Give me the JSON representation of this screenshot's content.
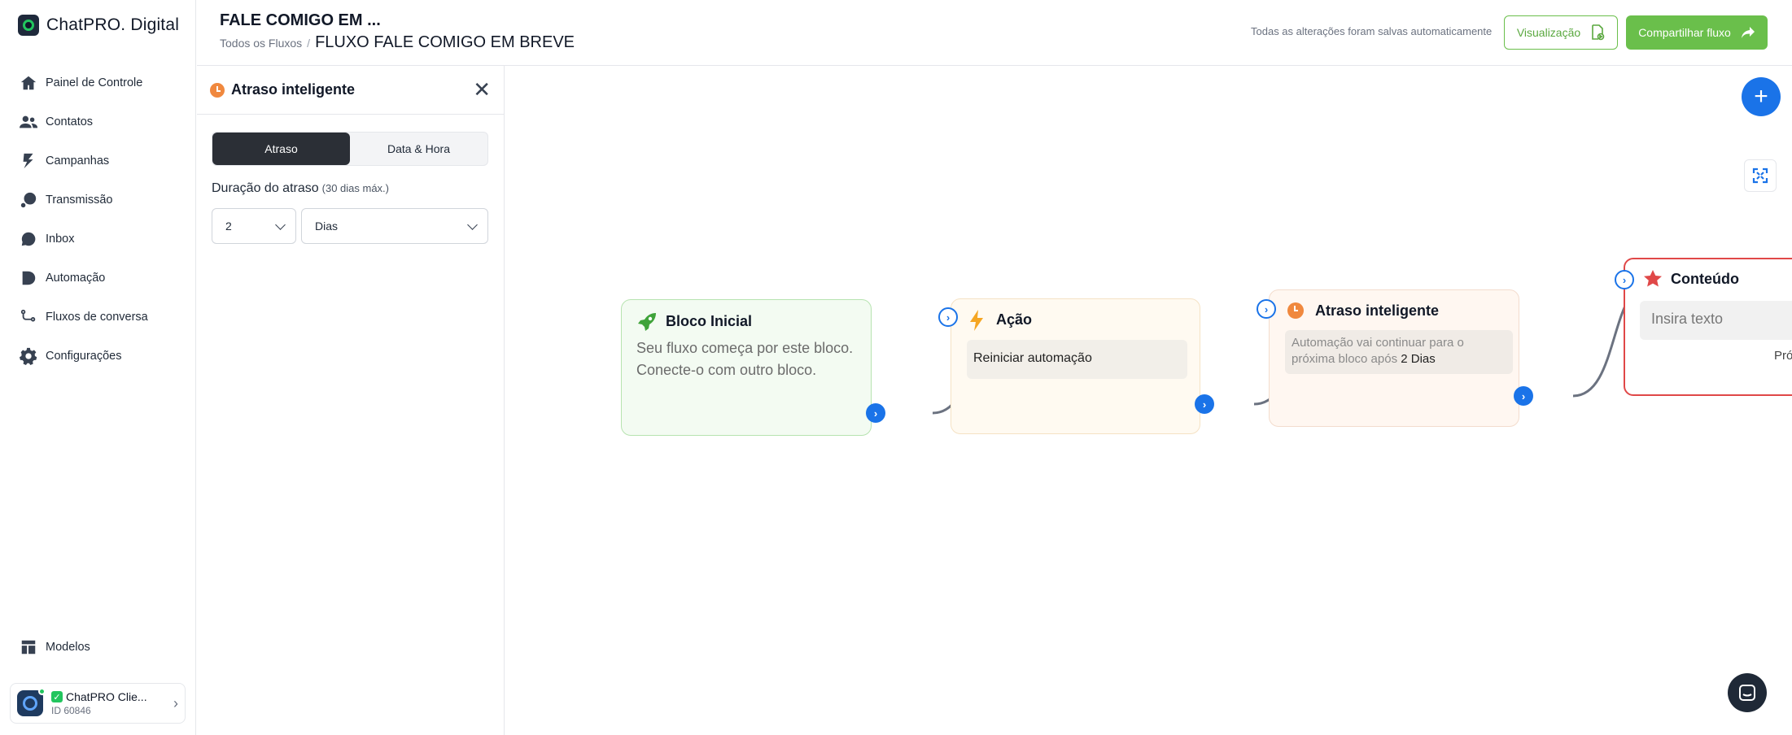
{
  "brand": {
    "name": "ChatPRO. Digital"
  },
  "sidebar": {
    "items": [
      {
        "label": "Painel de Controle",
        "icon": "home-icon"
      },
      {
        "label": "Contatos",
        "icon": "users-icon"
      },
      {
        "label": "Campanhas",
        "icon": "campaign-icon"
      },
      {
        "label": "Transmissão",
        "icon": "broadcast-icon"
      },
      {
        "label": "Inbox",
        "icon": "chat-icon"
      },
      {
        "label": "Automação",
        "icon": "automation-icon"
      },
      {
        "label": "Fluxos de conversa",
        "icon": "flow-icon"
      },
      {
        "label": "Configurações",
        "icon": "gear-icon"
      }
    ],
    "bottom_item": {
      "label": "Modelos",
      "icon": "templates-icon"
    },
    "account": {
      "name": "ChatPRO Clie...",
      "id": "ID 60846"
    }
  },
  "header": {
    "flow_title": "FALE COMIGO EM ...",
    "breadcrumb_link": "Todos os Fluxos",
    "breadcrumb_sep": "/",
    "breadcrumb_current": "FLUXO FALE COMIGO EM BREVE",
    "saved_status": "Todas as alterações foram salvas automaticamente",
    "preview_label": "Visualização",
    "share_label": "Compartilhar fluxo"
  },
  "panel": {
    "title": "Atraso inteligente",
    "tabs": [
      "Atraso",
      "Data & Hora"
    ],
    "active_tab": "Atraso",
    "duration_label": "Duração do atraso",
    "duration_hint": "(30 dias máx.)",
    "duration_value": "2",
    "duration_unit": "Dias"
  },
  "nodes": {
    "start": {
      "title": "Bloco Inicial",
      "text": "Seu fluxo começa por este bloco. Conecte-o com outro bloco."
    },
    "action": {
      "title": "Ação",
      "text": "Reiniciar automação"
    },
    "delay": {
      "title": "Atraso inteligente",
      "text": "Automação vai continuar para o próxima bloco após",
      "value": "2 Dias"
    },
    "content": {
      "title": "Conteúdo",
      "placeholder": "Insira texto",
      "next_label": "Pró"
    }
  },
  "colors": {
    "accent_green": "#6abf4b",
    "accent_blue": "#1a73e8",
    "delay_orange": "#f0883e",
    "content_red": "#e04848"
  }
}
